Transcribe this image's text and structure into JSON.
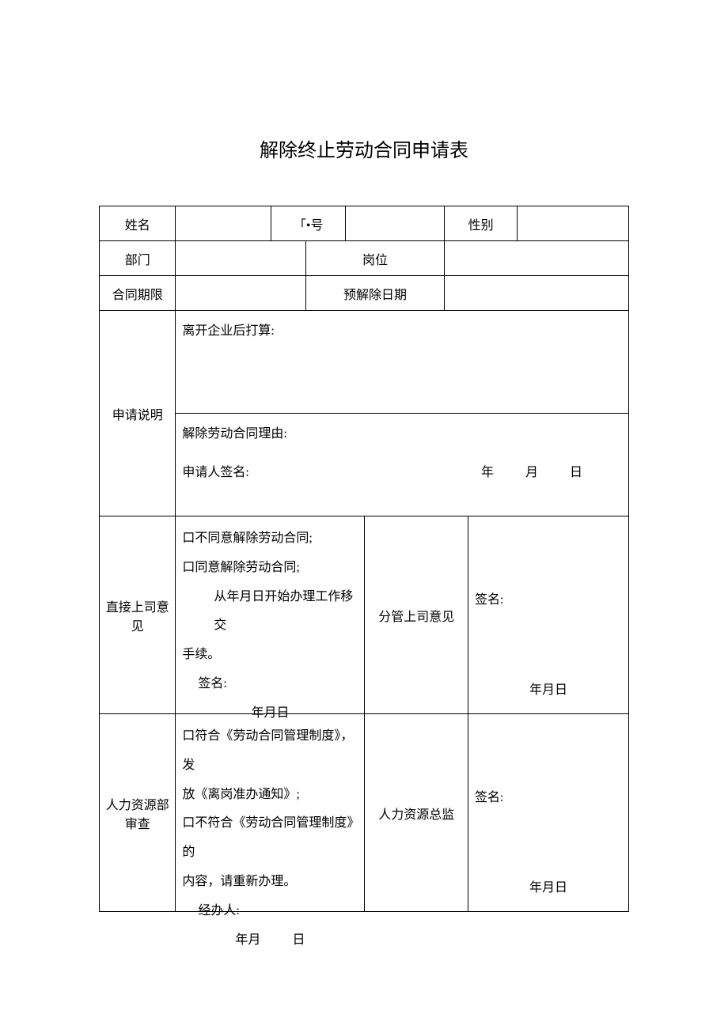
{
  "title": "解除终止劳动合同申请表",
  "row1": {
    "name_label": "姓名",
    "id_label": "「•号",
    "gender_label": "性别"
  },
  "row2": {
    "dept_label": "部门",
    "post_label": "岗位"
  },
  "row3": {
    "term_label": "合同期限",
    "predate_label": "预解除日期"
  },
  "app": {
    "label": "申请说明",
    "plan": "离开企业后打算:",
    "reason": "解除劳动合同理由:",
    "sign": "申请人签名:",
    "y": "年",
    "m": "月",
    "d": "日"
  },
  "direct": {
    "label": "直接上司意见",
    "opt1": "口不同意解除劳动合同;",
    "opt2": "口同意解除劳动合同;",
    "line3": "从年月日开始办理工作移交",
    "line4": "手续。",
    "sign": "签名:",
    "date": "年月日"
  },
  "supervisor": {
    "label": "分管上司意见",
    "sign": "签名:",
    "date": "年月日"
  },
  "hr": {
    "label": "人力资源部审查",
    "opt1": "口符合《劳动合同管理制度》，发",
    "opt1b": "放《离岗准办通知》;",
    "opt2": "口不符合《劳动合同管理制度》的",
    "opt2b": "内容，请重新办理。",
    "handler": "经办人:",
    "date_y": "年月",
    "date_d": "日"
  },
  "director": {
    "label": "人力资源总监",
    "sign": "签名:",
    "date": "年月日"
  }
}
